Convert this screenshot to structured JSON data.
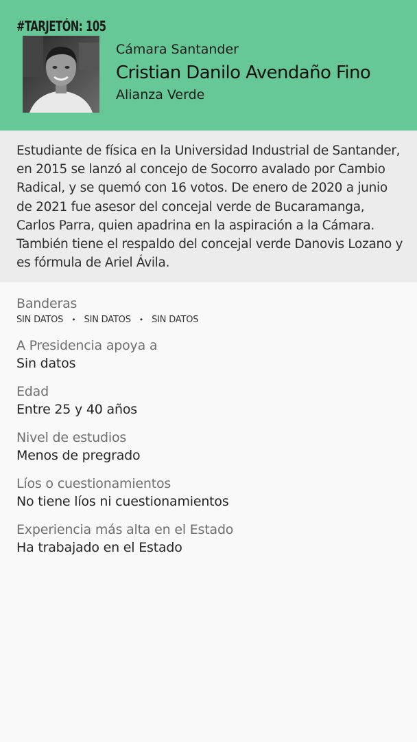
{
  "header": {
    "tag": "#TARJETÓN: 105",
    "chamber": "Cámara Santander",
    "name": "Cristian Danilo Avendaño Fino",
    "party": "Alianza Verde",
    "background_color": "#65c896"
  },
  "bio": "Estudiante de física en la Universidad Industrial de Santander, en 2015 se lanzó al concejo de Socorro avalado por Cambio Radical, y se quemó con 16 votos. De enero de 2020 a junio de 2021 fue asesor del concejal verde de Bucaramanga, Carlos Parra, quien apadrina en la aspiración a la Cámara. También tiene el respaldo del concejal verde Danovis Lozano y es fórmula de Ariel Ávila.",
  "banderas": {
    "label": "Banderas",
    "items": [
      "SIN DATOS",
      "SIN DATOS",
      "SIN DATOS"
    ]
  },
  "fields": [
    {
      "label": "A Presidencia apoya a",
      "value": "Sin datos"
    },
    {
      "label": "Edad",
      "value": "Entre 25 y 40 años"
    },
    {
      "label": "Nivel de estudios",
      "value": "Menos de pregrado"
    },
    {
      "label": "Líos o cuestionamientos",
      "value": "No tiene líos ni cuestionamientos"
    },
    {
      "label": "Experiencia más alta en el Estado",
      "value": "Ha trabajado en el Estado"
    }
  ]
}
